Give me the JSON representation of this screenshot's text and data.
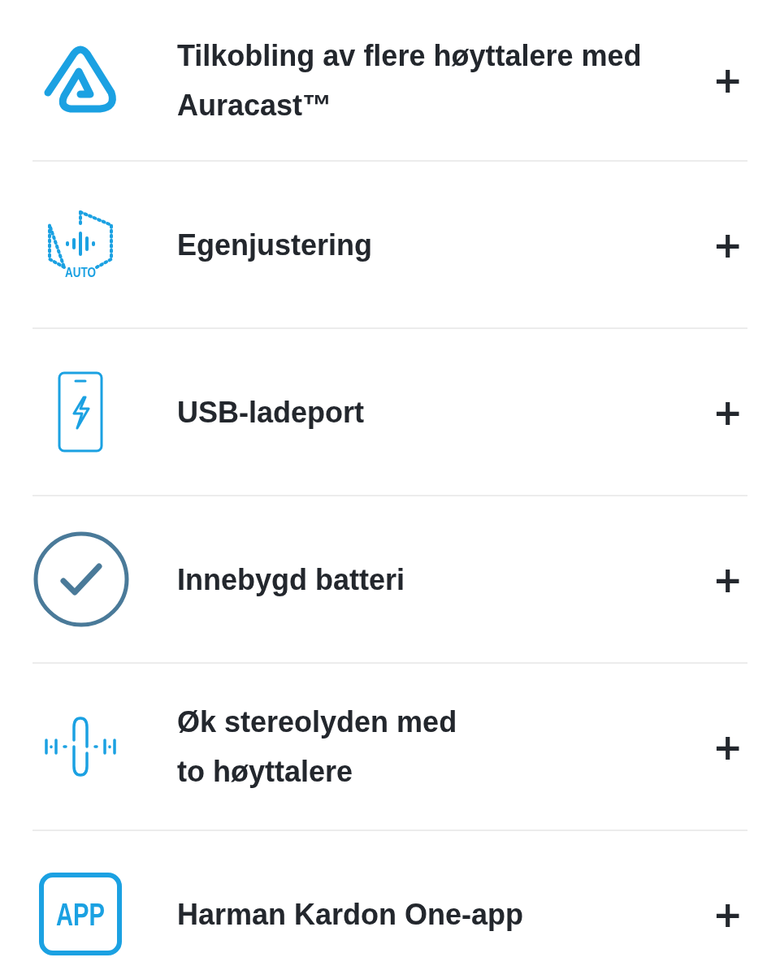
{
  "features": [
    {
      "kind": "auracast",
      "title": "Tilkobling av flere høyttalere med Auracast™",
      "toggle": "+"
    },
    {
      "kind": "auto",
      "icon_text": "AUTO",
      "title": "Egenjustering",
      "toggle": "+"
    },
    {
      "kind": "charging",
      "title": "USB-ladeport",
      "toggle": "+"
    },
    {
      "kind": "check",
      "title": "Innebygd batteri",
      "toggle": "+"
    },
    {
      "kind": "stereo",
      "title": "Øk stereolyden med\nto høyttalere",
      "toggle": "+"
    },
    {
      "kind": "app",
      "icon_text": "APP",
      "title": "Harman Kardon One-app",
      "toggle": "+"
    }
  ]
}
